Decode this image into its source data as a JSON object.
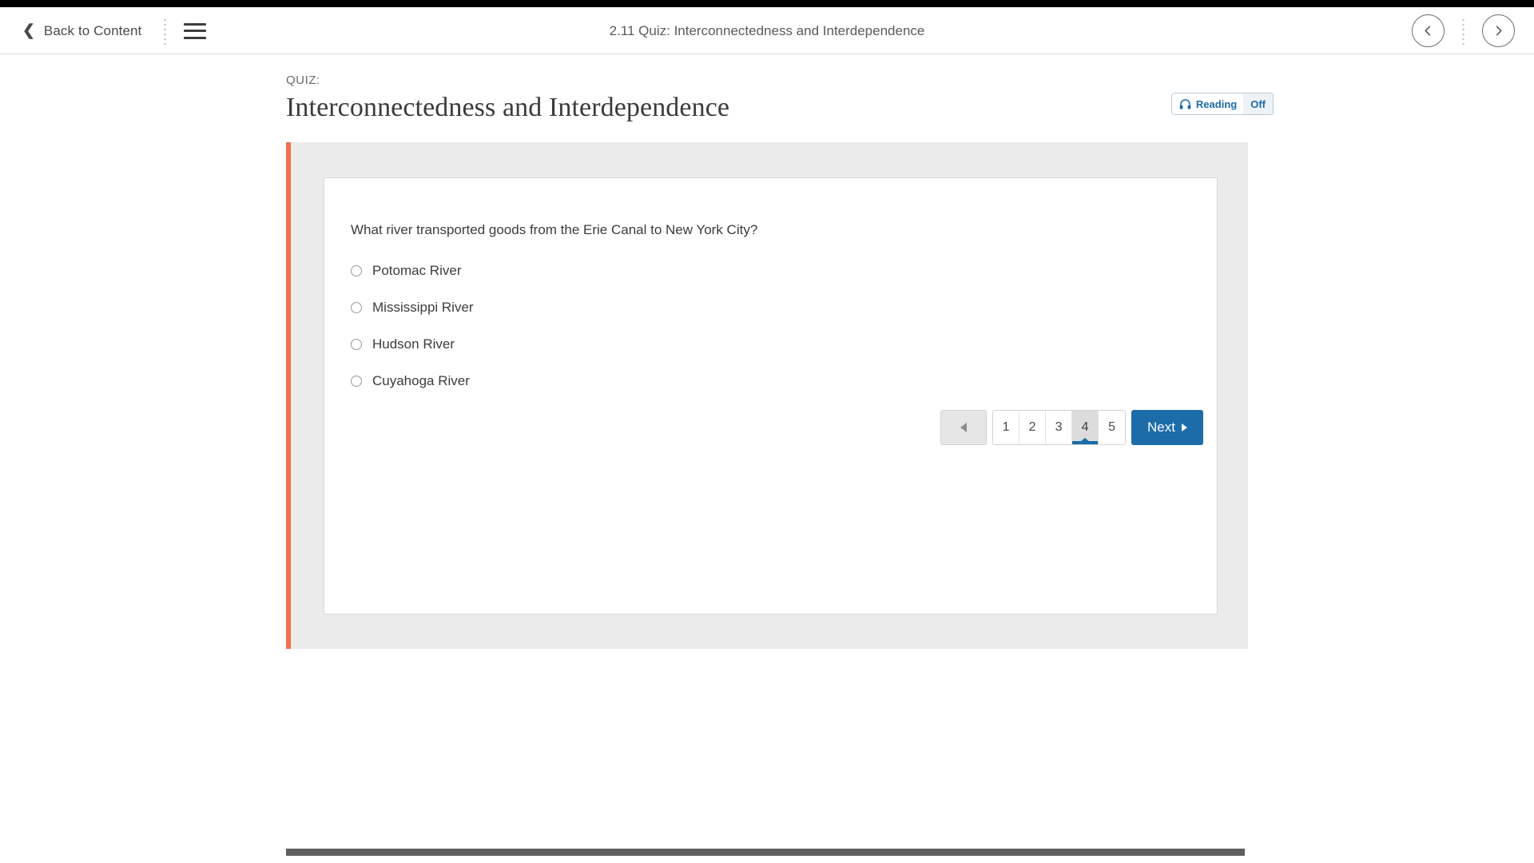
{
  "header": {
    "back_label": "Back to Content",
    "back_icon": "chevron-left-icon",
    "menu_icon": "hamburger-menu-icon",
    "dots_icon": "vertical-dots-divider-icon",
    "title": "2.11 Quiz: Interconnectedness and Interdependence",
    "prev_icon": "circle-chevron-left-icon",
    "next_icon": "circle-chevron-right-icon"
  },
  "quiz": {
    "kicker": "QUIZ:",
    "title": "Interconnectedness and Interdependence"
  },
  "reading": {
    "icon": "headphones-icon",
    "label": "Reading",
    "state": "Off"
  },
  "question": {
    "text": "What river transported goods from the Erie Canal to New York City?",
    "options": [
      {
        "label": "Potomac River",
        "selected": false
      },
      {
        "label": "Mississippi River",
        "selected": false
      },
      {
        "label": "Hudson River",
        "selected": false
      },
      {
        "label": "Cuyahoga River",
        "selected": false
      }
    ]
  },
  "pagination": {
    "prev_icon": "triangle-left-icon",
    "pages": [
      "1",
      "2",
      "3",
      "4",
      "5"
    ],
    "active_page": "4",
    "next_label": "Next",
    "next_icon": "triangle-right-icon"
  },
  "colors": {
    "accent_orange": "#f1704f",
    "primary_blue": "#1b6ca8",
    "panel_gray": "#ebebeb",
    "active_page_gray": "#dcdcdc"
  }
}
